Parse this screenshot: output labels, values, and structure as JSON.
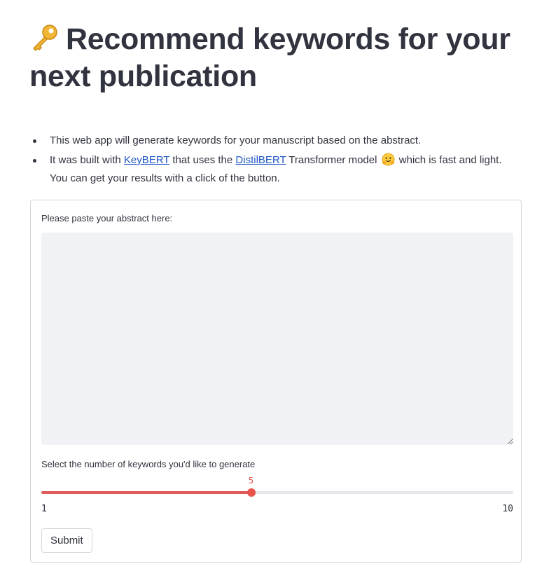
{
  "header": {
    "title": "Recommend keywords for your next publication",
    "title_icon": "key-emoji"
  },
  "intro": {
    "item1": "This web app will generate keywords for your manuscript based on the abstract.",
    "item2_before": "It was built with ",
    "keybert_link": "KeyBERT",
    "item2_middle": " that uses the ",
    "distilbert_link": "DistilBERT",
    "item2_after_link": " Transformer model ",
    "hug_icon": "hugging-face-emoji",
    "item2_end": " which is fast and light. You can get your results with a click of the button."
  },
  "form": {
    "abstract_label": "Please paste your abstract here:",
    "abstract_value": "",
    "slider_label": "Select the number of keywords you'd like to generate",
    "slider": {
      "min": 1,
      "max": 10,
      "value": 5,
      "min_label": "1",
      "max_label": "10",
      "value_label": "5"
    },
    "submit_label": "Submit"
  },
  "colors": {
    "accent": "#e8534c",
    "link": "#1f57c7",
    "text": "#31333f",
    "input_bg": "#f0f2f6"
  }
}
